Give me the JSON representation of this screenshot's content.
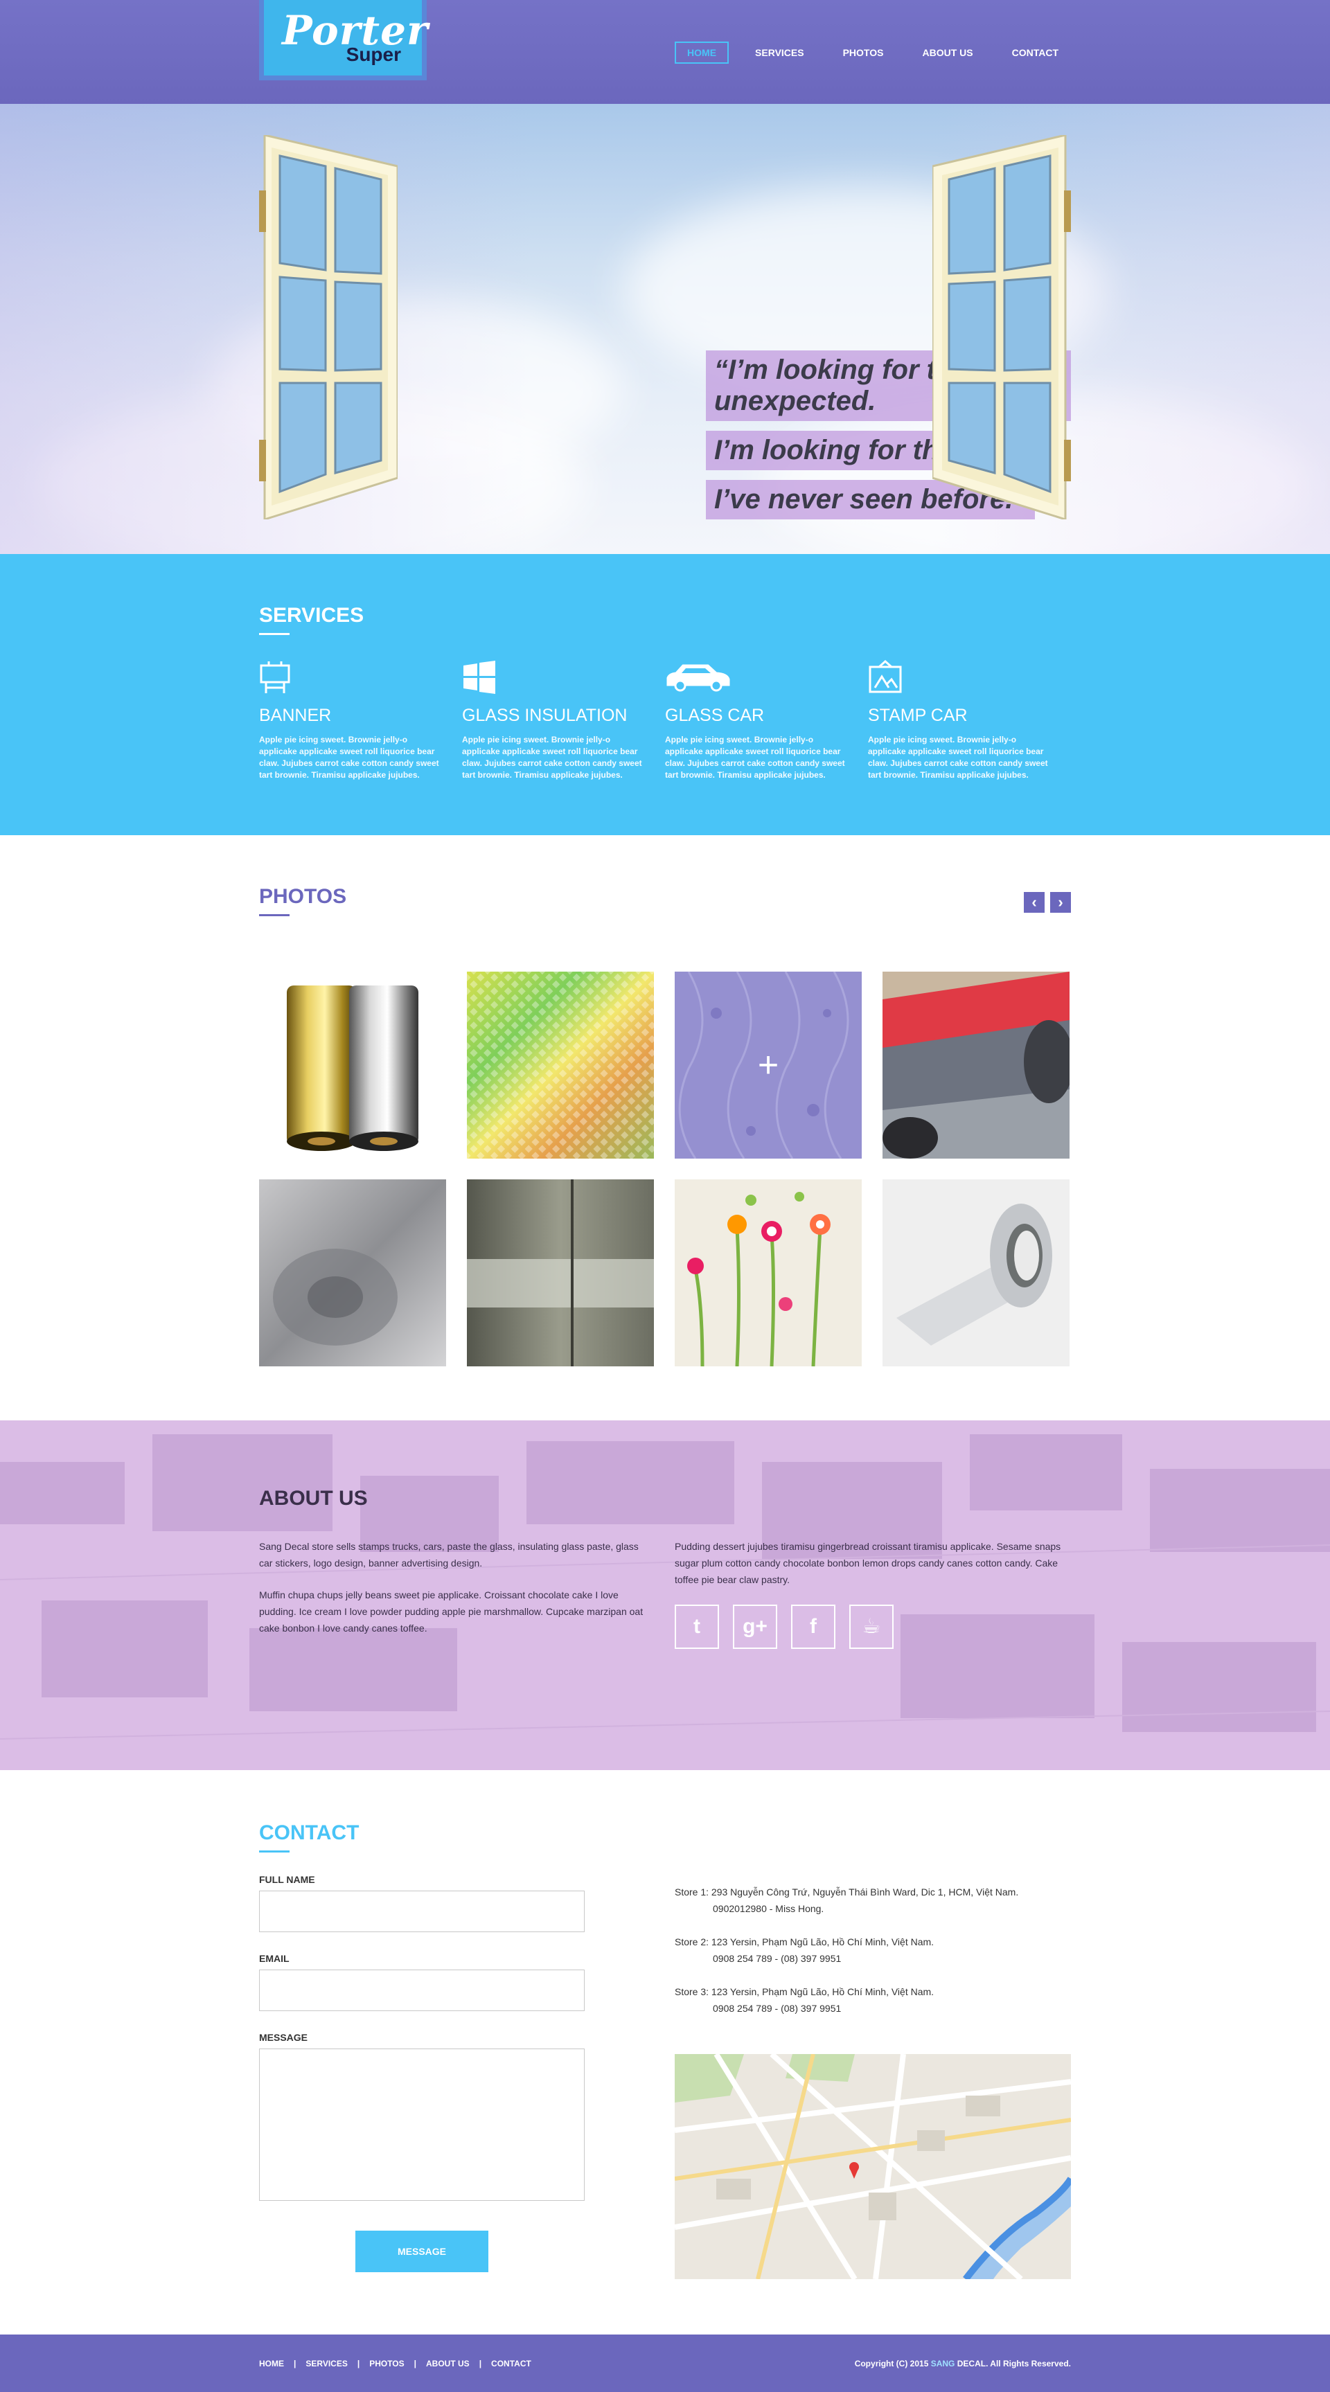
{
  "logo": {
    "line1": "Porter",
    "line2": "Super"
  },
  "nav": [
    {
      "label": "HOME"
    },
    {
      "label": "SERVICES"
    },
    {
      "label": "PHOTOS"
    },
    {
      "label": "ABOUT US"
    },
    {
      "label": "CONTACT"
    }
  ],
  "hero": {
    "quote_lines": [
      "“I’m looking for the unexpected.",
      "I’m looking for things",
      "I’ve never seen before.”"
    ]
  },
  "services": {
    "title": "SERVICES",
    "items": [
      {
        "icon": "billboard-icon",
        "title": "BANNER",
        "text": "Apple pie icing sweet. Brownie jelly-o applicake applicake sweet roll liquorice bear claw. Jujubes carrot cake cotton candy sweet tart brownie. Tiramisu applicake jujubes."
      },
      {
        "icon": "windows-icon",
        "title": "GLASS INSULATION",
        "text": "Apple pie icing sweet. Brownie jelly-o applicake applicake sweet roll liquorice bear claw. Jujubes carrot cake cotton candy sweet tart brownie. Tiramisu applicake jujubes."
      },
      {
        "icon": "car-icon",
        "title": "GLASS CAR",
        "text": "Apple pie icing sweet. Brownie jelly-o applicake applicake sweet roll liquorice bear claw. Jujubes carrot cake cotton candy sweet tart brownie. Tiramisu applicake jujubes."
      },
      {
        "icon": "picture-frame-icon",
        "title": "STAMP CAR",
        "text": "Apple pie icing sweet. Brownie jelly-o applicake applicake sweet roll liquorice bear claw. Jujubes carrot cake cotton candy sweet tart brownie. Tiramisu applicake jujubes."
      }
    ]
  },
  "photos": {
    "title": "PHOTOS",
    "prev": "‹",
    "next": "›",
    "hover_plus": "+"
  },
  "about": {
    "title": "ABOUT US",
    "left_paragraphs": [
      "Sang Decal store sells stamps trucks, cars, paste the glass, insulating glass paste, glass car stickers, logo design, banner advertising design.",
      "Muffin chupa chups jelly beans sweet pie applicake. Croissant chocolate cake I love pudding. Ice cream I love powder pudding apple pie marshmallow. Cupcake marzipan oat cake bonbon I love candy canes toffee."
    ],
    "right_paragraph": "Pudding dessert jujubes tiramisu gingerbread croissant tiramisu applicake. Sesame snaps sugar plum cotton candy chocolate bonbon lemon drops candy canes cotton candy. Cake toffee pie bear claw pastry.",
    "social": [
      {
        "icon": "twitter-icon",
        "glyph": "t"
      },
      {
        "icon": "google-plus-icon",
        "glyph": "g+"
      },
      {
        "icon": "facebook-icon",
        "glyph": "f"
      },
      {
        "icon": "coffee-cup-icon",
        "glyph": "☕"
      }
    ]
  },
  "contact": {
    "title": "CONTACT",
    "full_name_label": "FULL NAME",
    "email_label": "EMAIL",
    "message_label": "MESSAGE",
    "submit_label": "MESSAGE",
    "stores": [
      {
        "line1": "Store 1: 293 Nguyễn Công Trứ, Nguyễn Thái Bình Ward, Dic 1, HCM, Việt Nam.",
        "phone": "0902012980 - Miss Hong."
      },
      {
        "line1": "Store 2: 123 Yersin, Phạm Ngũ Lão, Hồ Chí Minh, Việt Nam.",
        "phone": "0908 254 789 - (08) 397 9951"
      },
      {
        "line1": "Store 3: 123 Yersin, Phạm Ngũ Lão, Hồ Chí Minh, Việt Nam.",
        "phone": "0908 254 789 - (08) 397 9951"
      }
    ]
  },
  "footer": {
    "links": [
      "HOME",
      "SERVICES",
      "PHOTOS",
      "ABOUT US",
      "CONTACT"
    ],
    "separator": "|",
    "copyright_pre": "Copyright (C) 2015",
    "brand": "SANG",
    "copyright_post": "DECAL. All Rights Reserved."
  },
  "colors": {
    "purple": "#6b67bd",
    "cyan": "#49c4f7",
    "lavender": "#dbbde6"
  }
}
